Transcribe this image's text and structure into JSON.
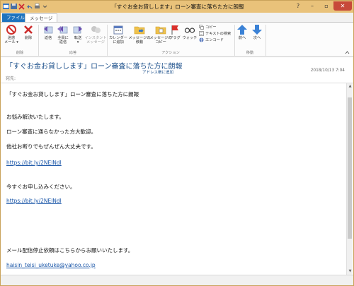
{
  "window": {
    "title": "「すぐお金お貸しします」ローン審査に落ちた方に朗報"
  },
  "tabs": {
    "file": "ファイル",
    "message": "メッセージ"
  },
  "ribbon": {
    "delete_group": {
      "label": "削除",
      "junk": "迷惑\nメール ▾",
      "delete": "削除"
    },
    "respond_group": {
      "label": "応答",
      "reply": "返信",
      "reply_all": "全員に\n返信",
      "forward": "転送\n▾",
      "im": "インスタント\nメッセージ"
    },
    "actions_group": {
      "label": "アクション",
      "add_calendar": "カレンダー\nに追加",
      "move": "メッセージの\n移動",
      "copy_message": "メッセージの\nコピー",
      "flag": "フラグ",
      "watch": "ウォッチ",
      "copy": "コピー",
      "find_text": "テキストの検索",
      "encode": "エンコード"
    },
    "move_group": {
      "label": "移動",
      "prev": "前へ",
      "next": "次へ"
    }
  },
  "header": {
    "subject": "「すぐお金お貸しします」ローン審査に落ちた方に朗報",
    "add_address": "アドレス帳に追加",
    "date": "2018/10/13 7:04",
    "to_label": "宛先:"
  },
  "body": {
    "lines": [
      "「すぐお金お貸しします」ローン審査に落ちた方に朗報",
      "お悩み解決いたします。",
      "ローン審査に通らなかった方大歓迎。",
      "他社お断りでもぜんぜん大丈夫です。",
      "https://bit.ly/2NElNdl",
      "今すぐお申し込みください。",
      "https://bit.ly/2NElNdl",
      "メール配信停止依頼はこちらからお願いいたします。",
      "haisin_teisi_uketuke@yahoo.co.jp"
    ]
  },
  "colors": {
    "titlebar": "#e9c27a",
    "file_tab": "#1e73be",
    "link": "#1a56a8",
    "subject": "#1a4e8a"
  }
}
